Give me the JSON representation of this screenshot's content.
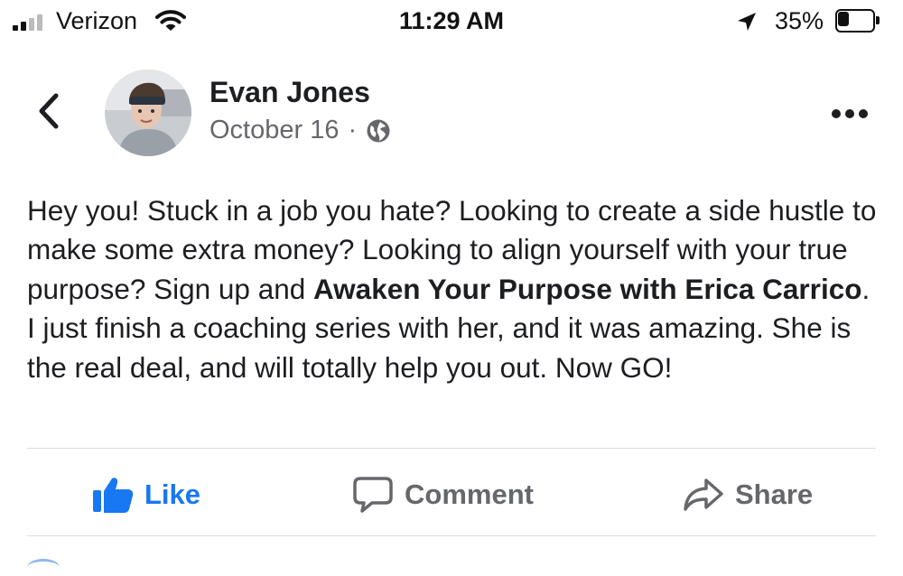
{
  "status_bar": {
    "carrier": "Verizon",
    "time": "11:29 AM",
    "battery_percent_label": "35%",
    "battery_level": 0.35,
    "icons": [
      "signal-icon",
      "wifi-icon",
      "location-arrow-icon",
      "battery-icon"
    ]
  },
  "post": {
    "author": "Evan Jones",
    "date": "October 16",
    "separator": "·",
    "privacy_icon": "globe-icon",
    "segments": [
      {
        "text": "Hey you! Stuck in a job you hate?  Looking to create a side hustle to make some extra money? Looking to align yourself with your true purpose? Sign up and ",
        "bold": false
      },
      {
        "text": "Awaken Your Purpose with Erica Carrico",
        "bold": true
      },
      {
        "text": ".  I just finish a coaching series with her, and it was amazing. She is the real deal, and will totally help you out. Now GO!",
        "bold": false
      }
    ]
  },
  "actions": {
    "like_label": "Like",
    "comment_label": "Comment",
    "share_label": "Share"
  },
  "colors": {
    "accent": "#1877f2",
    "text": "#1c1e21",
    "secondary_text": "#65676b",
    "divider": "#dadde1"
  }
}
